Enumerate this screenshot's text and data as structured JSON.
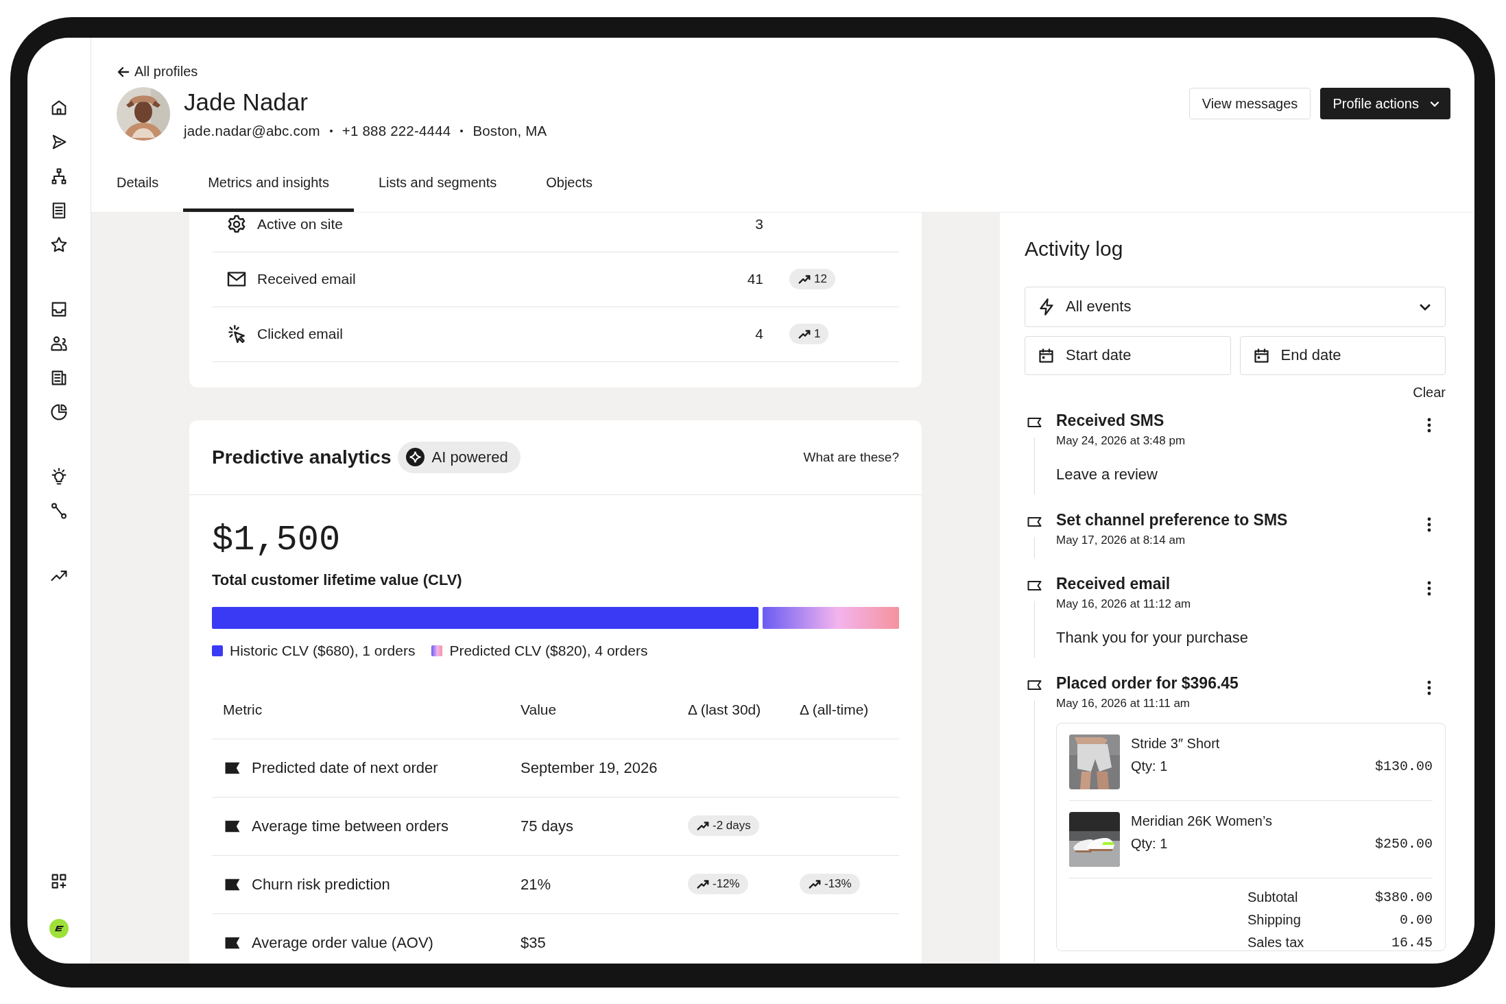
{
  "back_link": "All profiles",
  "profile": {
    "name": "Jade Nadar",
    "contact": [
      "jade.nadar@abc.com",
      "+1 888 222-4444",
      "Boston, MA"
    ]
  },
  "actions": {
    "secondary": "View messages",
    "primary": "Profile actions"
  },
  "tabs": [
    {
      "label": "Details",
      "selected": false
    },
    {
      "label": "Metrics and insights",
      "selected": true
    },
    {
      "label": "Lists and segments",
      "selected": false
    },
    {
      "label": "Objects",
      "selected": false
    }
  ],
  "engagement_rows": [
    {
      "label": "Active on site",
      "count": "3"
    },
    {
      "label": "Received email",
      "count": "41",
      "trend": "12"
    },
    {
      "label": "Clicked email",
      "count": "4",
      "trend": "1"
    }
  ],
  "predictive": {
    "title": "Predictive analytics",
    "badge": "AI powered",
    "help_link": "What are these?",
    "clv_value": "$1,500",
    "clv_label": "Total customer lifetime value (CLV)",
    "clv_segments": [
      {
        "kind": "solid",
        "label": "Historic CLV ($680), 1 orders"
      },
      {
        "kind": "gradient",
        "label": "Predicted CLV ($820), 4 orders"
      }
    ],
    "table": {
      "columns": [
        "Metric",
        "Value",
        "Δ (last 30d)",
        "Δ (all-time)"
      ],
      "rows": [
        {
          "metric": "Predicted date of next order",
          "value": "September 19, 2026"
        },
        {
          "metric": "Average time between orders",
          "value": "75 days",
          "delta_30d": "-2 days"
        },
        {
          "metric": "Churn risk prediction",
          "value": "21%",
          "delta_30d": "-12%",
          "delta_all": "-13%"
        },
        {
          "metric": "Average order value (AOV)",
          "value": "$35"
        }
      ]
    }
  },
  "activity_log": {
    "title": "Activity log",
    "event_filter": "All events",
    "start_date": {
      "placeholder": "Start date"
    },
    "end_date": {
      "placeholder": "End date"
    },
    "clear": "Clear",
    "events": [
      {
        "title": "Received SMS",
        "time": "May 24, 2026 at 3:48 pm",
        "message": "Leave a review"
      },
      {
        "title": "Set channel preference to SMS",
        "time": "May 17, 2026 at 8:14 am"
      },
      {
        "title": "Received email",
        "time": "May 16, 2026 at 11:12 am",
        "message": "Thank you for your purchase"
      },
      {
        "title": "Placed order for $396.45",
        "time": "May 16, 2026 at 11:11 am",
        "order": {
          "items": [
            {
              "kind": "shorts",
              "name": "Stride 3″ Short",
              "qty": "Qty: 1",
              "price": "$130.00"
            },
            {
              "kind": "sneakers",
              "name": "Meridian 26K Women’s",
              "qty": "Qty: 1",
              "price": "$250.00"
            }
          ],
          "totals": [
            {
              "label": "Subtotal",
              "value": "$380.00"
            },
            {
              "label": "Shipping",
              "value": "0.00"
            },
            {
              "label": "Sales tax",
              "value": "16.45"
            }
          ]
        }
      }
    ]
  }
}
